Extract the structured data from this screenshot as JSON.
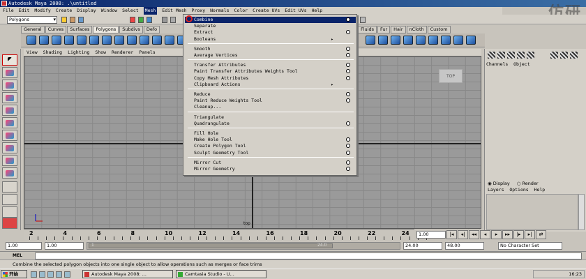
{
  "window": {
    "title": "Autodesk Maya 2008: .\\untitled"
  },
  "watermark": {
    "text": "仿研"
  },
  "menubar": {
    "items": [
      "File",
      "Edit",
      "Modify",
      "Create",
      "Display",
      "Window",
      "Select",
      "Mesh",
      "Edit Mesh",
      "Proxy",
      "Normals",
      "Color",
      "Create UVs",
      "Edit UVs",
      "Help"
    ],
    "active_index": 7
  },
  "status_line": {
    "mode": "Polygons"
  },
  "shelf": {
    "tabs": [
      "General",
      "Curves",
      "Surfaces",
      "Polygons",
      "Subdivs",
      "Defo"
    ],
    "active_tab": "Polygons",
    "tabs_right": [
      "Fluids",
      "Fur",
      "Hair",
      "nCloth",
      "Custom"
    ]
  },
  "panel_menu": [
    "View",
    "Shading",
    "Lighting",
    "Show",
    "Renderer",
    "Panels"
  ],
  "viewport": {
    "viewcube_label": "TOP",
    "camera_label": "top"
  },
  "mesh_menu": {
    "groups": [
      [
        {
          "label": "Combine",
          "option": true,
          "highlight": true
        },
        {
          "label": "Separate"
        },
        {
          "label": "Extract",
          "option": true
        },
        {
          "label": "Booleans",
          "submenu": true
        }
      ],
      [
        {
          "label": "Smooth",
          "option": true
        },
        {
          "label": "Average Vertices",
          "option": true
        }
      ],
      [
        {
          "label": "Transfer Attributes",
          "option": true
        },
        {
          "label": "Paint Transfer Attributes Weights Tool",
          "option": true
        },
        {
          "label": "Copy Mesh Attributes",
          "option": true
        },
        {
          "label": "Clipboard Actions",
          "submenu": true
        }
      ],
      [
        {
          "label": "Reduce",
          "option": true
        },
        {
          "label": "Paint Reduce Weights Tool",
          "option": true
        },
        {
          "label": "Cleanup...",
          "option": false
        }
      ],
      [
        {
          "label": "Triangulate"
        },
        {
          "label": "Quadrangulate",
          "option": true
        }
      ],
      [
        {
          "label": "Fill Hole"
        },
        {
          "label": "Make Hole Tool",
          "option": true
        },
        {
          "label": "Create Polygon Tool",
          "option": true
        },
        {
          "label": "Sculpt Geometry Tool",
          "option": true
        }
      ],
      [
        {
          "label": "Mirror Cut",
          "option": true
        },
        {
          "label": "Mirror Geometry",
          "option": true
        }
      ]
    ]
  },
  "channel_box": {
    "menu": [
      "Channels",
      "Object"
    ]
  },
  "layer_editor": {
    "mode_display": "Display",
    "mode_render": "Render",
    "menu": [
      "Layers",
      "Options",
      "Help"
    ]
  },
  "timeline": {
    "ticks": [
      "2",
      "4",
      "6",
      "8",
      "10",
      "12",
      "14",
      "16",
      "18",
      "20",
      "22",
      "24"
    ],
    "current_frame": "1.00"
  },
  "range": {
    "start": "1.00",
    "playback_start": "1.00",
    "slider_start": "1",
    "slider_end": "24.0",
    "playback_end": "24.00",
    "end": "48.00",
    "character_set": "No Character Set"
  },
  "command_line": {
    "label": "MEL"
  },
  "help_line": {
    "text": "Combine the selected polygon objects into one single object to allow operations such as merges or face trims"
  },
  "taskbar": {
    "start": "开始",
    "buttons": [
      "Autodesk Maya 2008: ...",
      "Camtasia Studio - U..."
    ],
    "clock": "16:23"
  }
}
